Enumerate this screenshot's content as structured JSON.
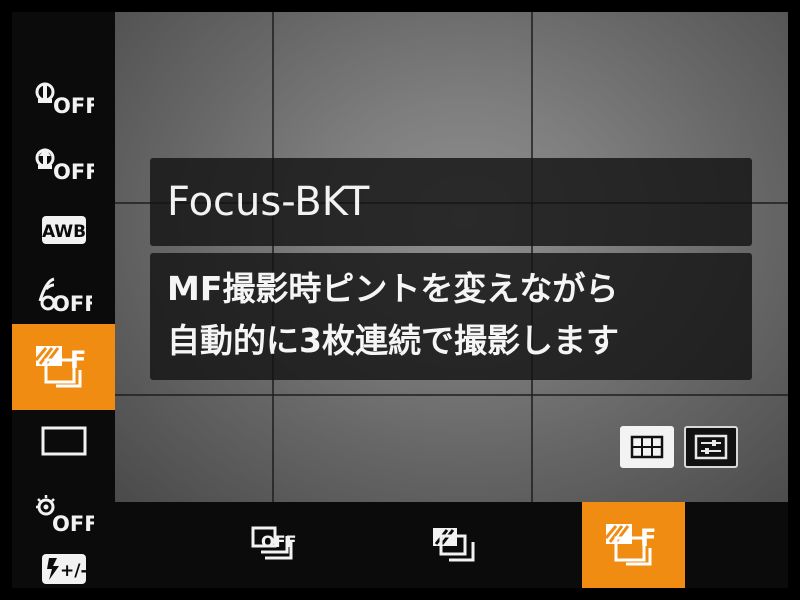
{
  "panel": {
    "title": "Focus-BKT",
    "description": [
      "MF撮影時ピントを変えながら",
      "自動的に3枚連続で撮影します"
    ]
  },
  "sidebar": {
    "items": [
      {
        "icon": "self-timer-off-icon",
        "label": "OFF"
      },
      {
        "icon": "self-timer-2s-off-icon",
        "label": "OFF"
      },
      {
        "icon": "awb-icon",
        "label": "AWB"
      },
      {
        "icon": "metering-off-icon",
        "label": "OFF"
      },
      {
        "icon": "focus-bracket-icon",
        "label": "F",
        "selected": true
      },
      {
        "icon": "single-shot-icon",
        "label": ""
      },
      {
        "icon": "hdr-off-icon",
        "label": "OFF"
      },
      {
        "icon": "flash-compensation-icon",
        "label": "+/-"
      }
    ]
  },
  "bottom_bar": {
    "items": [
      {
        "icon": "bracket-off-icon",
        "label": "OFF"
      },
      {
        "icon": "exposure-bracket-icon",
        "label": ""
      },
      {
        "icon": "focus-bracket-icon",
        "label": "F",
        "selected": true
      }
    ]
  },
  "view_toggle": {
    "items": [
      {
        "icon": "grid-view-icon",
        "selected": true
      },
      {
        "icon": "settings-sliders-icon",
        "selected": false
      }
    ]
  },
  "colors": {
    "accent": "#f08c12",
    "panel_bg": "#141414",
    "text": "#f2f2f2"
  }
}
